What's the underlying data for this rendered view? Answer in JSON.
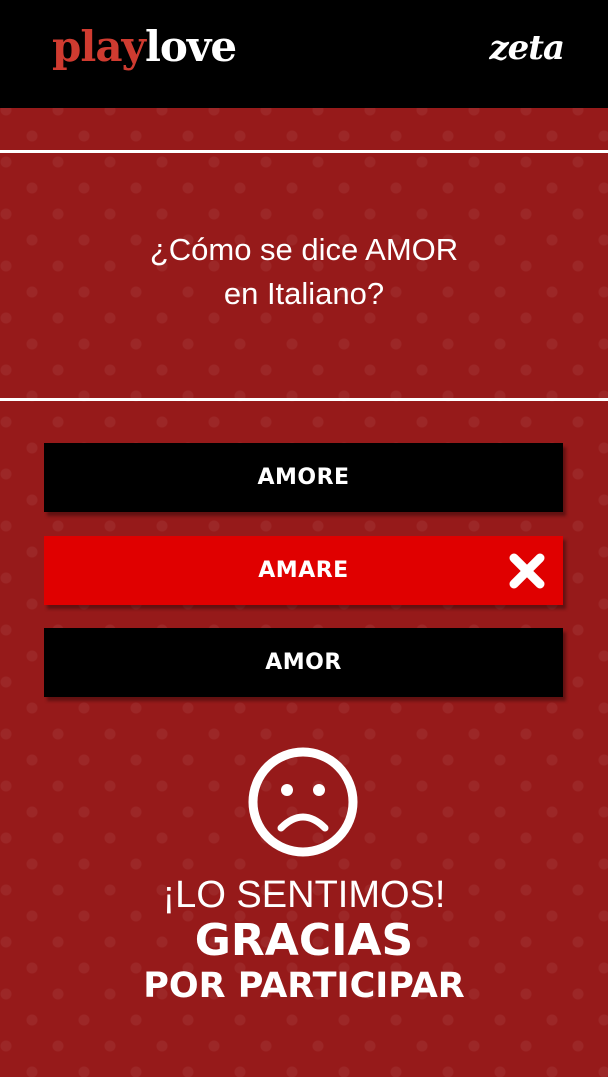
{
  "header": {
    "logo_play": "play",
    "logo_love": "love",
    "partner_logo": "zeta"
  },
  "question": {
    "line1": "¿Cómo se dice AMOR",
    "line2": "en Italiano?"
  },
  "answers": [
    {
      "label": "AMORE",
      "state": "default"
    },
    {
      "label": "AMARE",
      "state": "wrong",
      "icon": "close-icon"
    },
    {
      "label": "AMOR",
      "state": "default"
    }
  ],
  "result": {
    "icon": "sad-face-icon",
    "line1": "¡LO SENTIMOS!",
    "line2": "GRACIAS",
    "line3": "POR PARTICIPAR"
  },
  "colors": {
    "background": "#961a1a",
    "header": "#000000",
    "wrong_answer": "#e00000",
    "answer": "#000000",
    "logo_accent": "#cf3b30"
  }
}
